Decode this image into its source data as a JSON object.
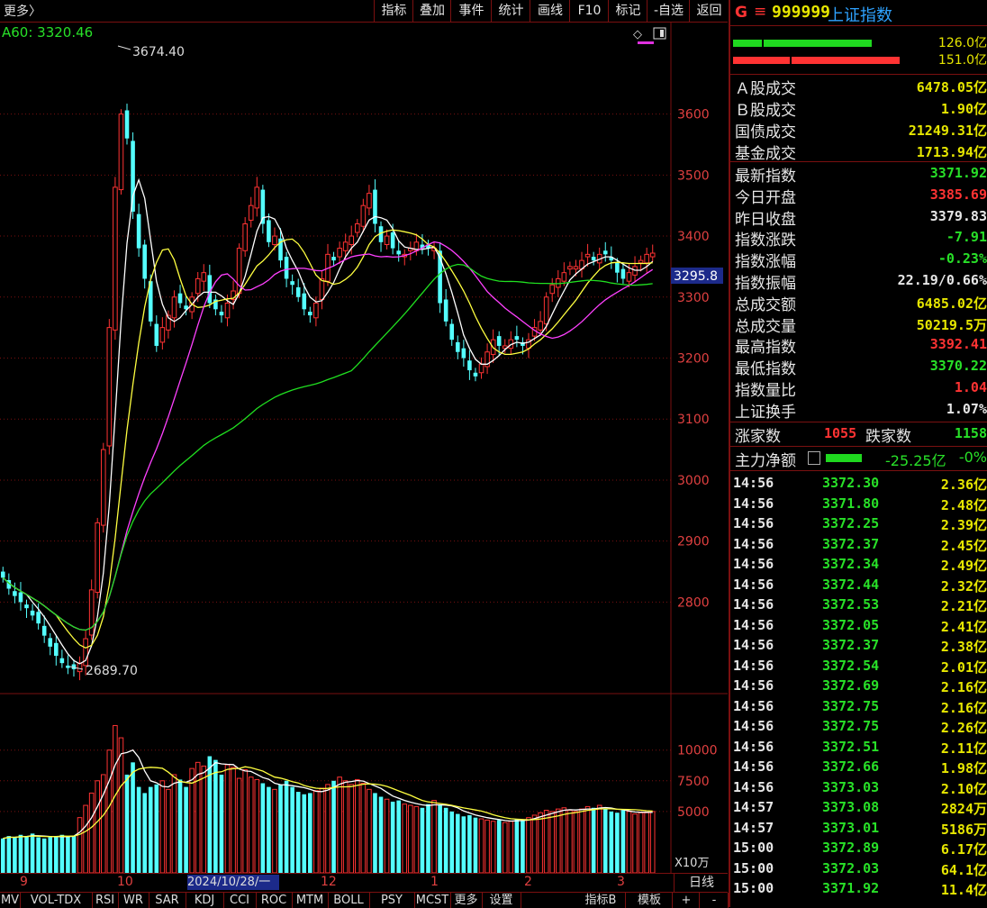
{
  "toolbar": {
    "more_label": "更多〉",
    "items": [
      "指标",
      "叠加",
      "事件",
      "统计",
      "画线",
      "F10",
      "标记",
      "-自选",
      "返回"
    ]
  },
  "main_chart": {
    "ma_label": "A60: 3320.46",
    "high_annotation": "3674.40",
    "low_annotation": "2689.70",
    "current_price_tag": "3295.8",
    "y_ticks": [
      "3600",
      "3500",
      "3400",
      "3300",
      "3200",
      "3100",
      "3000",
      "2900",
      "2800"
    ]
  },
  "volume_chart": {
    "y_ticks": [
      "10000",
      "7500",
      "5000"
    ],
    "unit_label": "X10万"
  },
  "date_axis": {
    "labels": [
      "9",
      "10",
      "12",
      "1",
      "2",
      "3"
    ],
    "selected_date": "2024/10/28/一",
    "period_label": "日线"
  },
  "indicator_tabs": [
    "MV",
    "VOL-TDX",
    "RSI",
    "WR",
    "SAR",
    "KDJ",
    "CCI",
    "ROC",
    "MTM",
    "BOLL",
    "PSY",
    "MCST",
    "更多",
    "设置",
    "指标B",
    "模板",
    "+",
    "-"
  ],
  "quote_panel": {
    "g_mark": "G",
    "menu_icon": "≡",
    "code": "999999",
    "name": "上证指数",
    "bar_top_value": "126.0亿",
    "bar_bottom_value": "151.0亿",
    "turnover": [
      {
        "label": "Ａ股成交",
        "value": "6478.05亿"
      },
      {
        "label": "Ｂ股成交",
        "value": "1.90亿"
      },
      {
        "label": "国债成交",
        "value": "21249.31亿"
      },
      {
        "label": "基金成交",
        "value": "1713.94亿"
      }
    ],
    "stats": [
      {
        "label": "最新指数",
        "value": "3371.92",
        "color": "#28e028"
      },
      {
        "label": "今日开盘",
        "value": "3385.69",
        "color": "#ff3333"
      },
      {
        "label": "昨日收盘",
        "value": "3379.83",
        "color": "#e6e6e6"
      },
      {
        "label": "指数涨跌",
        "value": "-7.91",
        "color": "#28e028"
      },
      {
        "label": "指数涨幅",
        "value": "-0.23%",
        "color": "#28e028"
      },
      {
        "label": "指数振幅",
        "value": "22.19/0.66%",
        "color": "#e6e6e6"
      },
      {
        "label": "总成交额",
        "value": "6485.02亿",
        "color": "#e6e600"
      },
      {
        "label": "总成交量",
        "value": "50219.5万",
        "color": "#e6e600"
      },
      {
        "label": "最高指数",
        "value": "3392.41",
        "color": "#ff3333"
      },
      {
        "label": "最低指数",
        "value": "3370.22",
        "color": "#28e028"
      },
      {
        "label": "指数量比",
        "value": "1.04",
        "color": "#ff3333"
      },
      {
        "label": "上证换手",
        "value": "1.07%",
        "color": "#e6e6e6"
      }
    ],
    "breadth": {
      "up_label": "涨家数",
      "up_value": "1055",
      "down_label": "跌家数",
      "down_value": "1158"
    },
    "main_flow": {
      "label": "主力净额",
      "value": "-25.25亿",
      "pct": "-0%"
    },
    "ticks": [
      {
        "time": "14:56",
        "price": "3372.30",
        "vol": "2.36亿"
      },
      {
        "time": "14:56",
        "price": "3371.80",
        "vol": "2.48亿"
      },
      {
        "time": "14:56",
        "price": "3372.25",
        "vol": "2.39亿"
      },
      {
        "time": "14:56",
        "price": "3372.37",
        "vol": "2.45亿"
      },
      {
        "time": "14:56",
        "price": "3372.34",
        "vol": "2.49亿"
      },
      {
        "time": "14:56",
        "price": "3372.44",
        "vol": "2.32亿"
      },
      {
        "time": "14:56",
        "price": "3372.53",
        "vol": "2.21亿"
      },
      {
        "time": "14:56",
        "price": "3372.05",
        "vol": "2.41亿"
      },
      {
        "time": "14:56",
        "price": "3372.37",
        "vol": "2.38亿"
      },
      {
        "time": "14:56",
        "price": "3372.54",
        "vol": "2.01亿"
      },
      {
        "time": "14:56",
        "price": "3372.69",
        "vol": "2.16亿"
      },
      {
        "time": "14:56",
        "price": "3372.75",
        "vol": "2.16亿"
      },
      {
        "time": "14:56",
        "price": "3372.75",
        "vol": "2.26亿"
      },
      {
        "time": "14:56",
        "price": "3372.51",
        "vol": "2.11亿"
      },
      {
        "time": "14:56",
        "price": "3372.66",
        "vol": "1.98亿"
      },
      {
        "time": "14:56",
        "price": "3373.03",
        "vol": "2.10亿"
      },
      {
        "time": "14:57",
        "price": "3373.08",
        "vol": "2824万"
      },
      {
        "time": "14:57",
        "price": "3373.01",
        "vol": "5186万"
      },
      {
        "time": "15:00",
        "price": "3372.89",
        "vol": "6.17亿"
      },
      {
        "time": "15:00",
        "price": "3372.03",
        "vol": "64.1亿"
      },
      {
        "time": "15:00",
        "price": "3371.92",
        "vol": "11.4亿"
      }
    ]
  },
  "chart_data": {
    "type": "candlestick",
    "ylim": [
      2650,
      3750
    ],
    "ma_levels": [
      {
        "name": "A60",
        "value": 3320.46
      }
    ],
    "closes": [
      2840,
      2822,
      2810,
      2800,
      2790,
      2778,
      2765,
      2745,
      2727,
      2712,
      2700,
      2692,
      2690,
      2700,
      2740,
      2820,
      2930,
      3050,
      3250,
      3480,
      3600,
      3560,
      3440,
      3380,
      3330,
      3260,
      3220,
      3250,
      3270,
      3300,
      3290,
      3280,
      3300,
      3330,
      3340,
      3290,
      3280,
      3270,
      3290,
      3310,
      3380,
      3420,
      3450,
      3480,
      3420,
      3390,
      3400,
      3360,
      3330,
      3320,
      3300,
      3280,
      3270,
      3290,
      3330,
      3370,
      3360,
      3380,
      3390,
      3400,
      3420,
      3450,
      3470,
      3420,
      3390,
      3400,
      3380,
      3370,
      3370,
      3380,
      3390,
      3380,
      3380,
      3380,
      3290,
      3260,
      3230,
      3210,
      3200,
      3180,
      3170,
      3190,
      3210,
      3230,
      3220,
      3220,
      3230,
      3230,
      3220,
      3230,
      3250,
      3260,
      3300,
      3320,
      3330,
      3340,
      3350,
      3350,
      3360,
      3370,
      3360,
      3370,
      3370,
      3360,
      3340,
      3330,
      3340,
      3350,
      3360,
      3370,
      3372
    ],
    "volumes": [
      2800,
      3000,
      2900,
      3100,
      3000,
      3200,
      2900,
      2800,
      2900,
      3000,
      3100,
      2950,
      3000,
      4500,
      5500,
      6500,
      7500,
      8000,
      10000,
      12000,
      11000,
      8000,
      9000,
      7000,
      6500,
      7000,
      7200,
      7500,
      6800,
      8000,
      7600,
      7000,
      8500,
      9000,
      8700,
      9500,
      9200,
      8000,
      8800,
      8600,
      7700,
      8400,
      7800,
      7600,
      7300,
      7000,
      6800,
      7200,
      7500,
      7000,
      6600,
      6400,
      6500,
      6700,
      6900,
      7200,
      7500,
      7800,
      7500,
      7200,
      7600,
      7300,
      6800,
      6500,
      6200,
      6000,
      5800,
      5900,
      5600,
      5500,
      5400,
      5300,
      5600,
      5900,
      5500,
      5300,
      5000,
      4800,
      4600,
      4700,
      4500,
      4400,
      4300,
      4200,
      4300,
      4100,
      4200,
      4400,
      4300,
      4500,
      4700,
      4900,
      5100,
      5000,
      5200,
      5300,
      5100,
      5000,
      5200,
      5400,
      5300,
      5500,
      5200,
      5000,
      4900,
      5100,
      5000,
      4800,
      4900,
      4900,
      5000
    ]
  }
}
